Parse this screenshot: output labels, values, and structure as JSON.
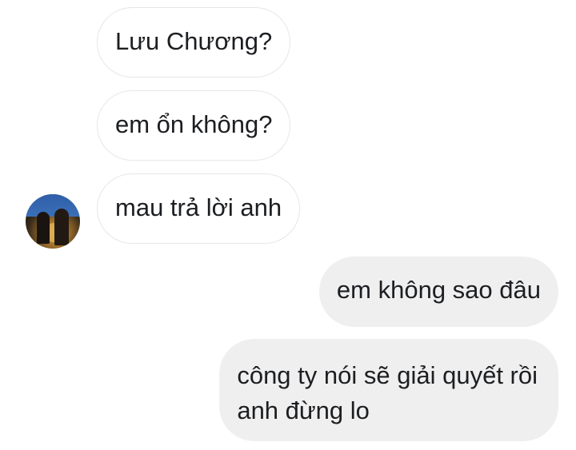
{
  "messages": [
    {
      "direction": "incoming",
      "text": "Lưu Chương?"
    },
    {
      "direction": "incoming",
      "text": "em ổn không?"
    },
    {
      "direction": "incoming",
      "text": "mau trả lời anh"
    },
    {
      "direction": "outgoing",
      "text": "em không sao đâu"
    },
    {
      "direction": "outgoing",
      "lines": [
        "công ty nói sẽ giải quyết rồi",
        "anh đừng lo"
      ]
    }
  ],
  "colors": {
    "incoming_bubble": "#ffffff",
    "incoming_border": "#e6e6e6",
    "outgoing_bubble": "#efefef",
    "text": "#1c1e21"
  }
}
